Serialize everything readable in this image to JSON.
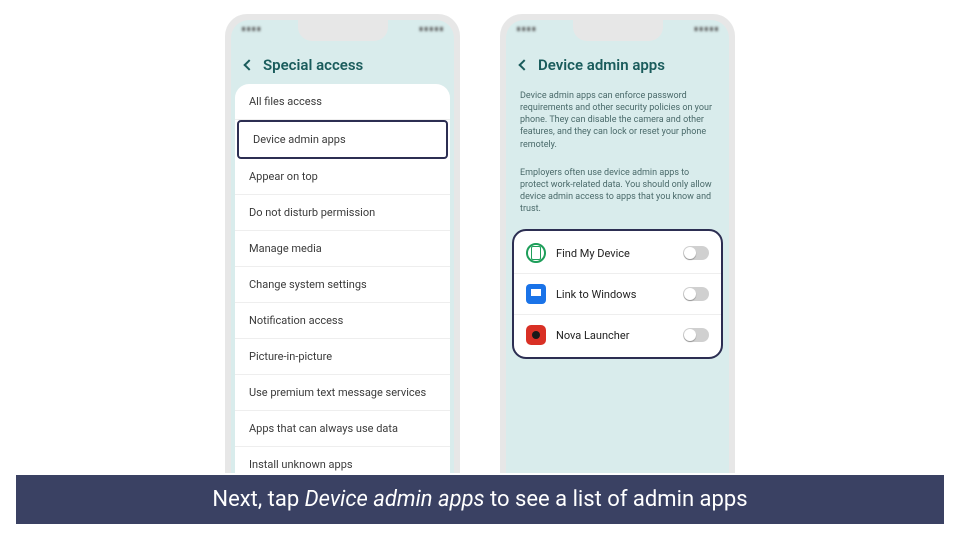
{
  "left": {
    "title": "Special access",
    "items": [
      "All files access",
      "Device admin apps",
      "Appear on top",
      "Do not disturb permission",
      "Manage media",
      "Change system settings",
      "Notification access",
      "Picture-in-picture",
      "Use premium text message services",
      "Apps that can always use data",
      "Install unknown apps"
    ],
    "highlightIndex": 1
  },
  "right": {
    "title": "Device admin apps",
    "desc1": "Device admin apps can enforce password requirements and other security policies on your phone. They can disable the camera and other features, and they can lock or reset your phone remotely.",
    "desc2": "Employers often use device admin apps to protect work-related data. You should only allow device admin access to apps that you know and trust.",
    "apps": [
      {
        "name": "Find My Device",
        "icon": "find",
        "enabled": false
      },
      {
        "name": "Link to Windows",
        "icon": "link",
        "enabled": false
      },
      {
        "name": "Nova Launcher",
        "icon": "nova",
        "enabled": false
      }
    ]
  },
  "caption": {
    "pre": "Next, tap ",
    "em": "Device admin apps",
    "post": " to see a list of admin apps"
  }
}
